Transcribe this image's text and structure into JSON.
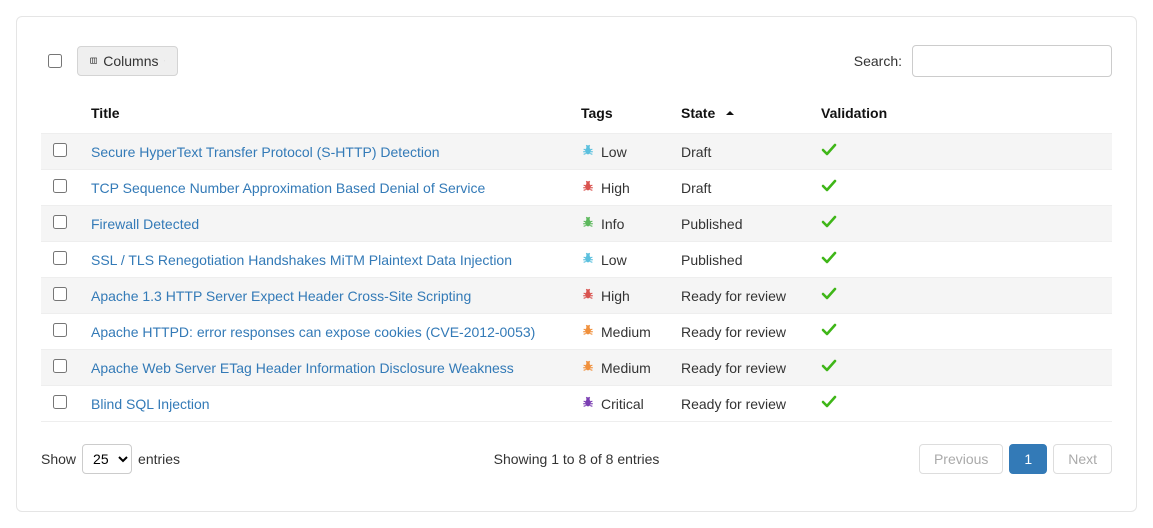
{
  "toolbar": {
    "columns_label": "Columns",
    "search_label": "Search:"
  },
  "columns": {
    "title": "Title",
    "tags": "Tags",
    "state": "State",
    "validation": "Validation"
  },
  "severity_colors": {
    "Critical": "#7b3fb3",
    "High": "#d9534f",
    "Medium": "#f0903c",
    "Low": "#5bc0de",
    "Info": "#5cb85c"
  },
  "rows": [
    {
      "title": "Secure HyperText Transfer Protocol (S-HTTP) Detection",
      "severity": "Low",
      "state": "Draft",
      "validated": true
    },
    {
      "title": "TCP Sequence Number Approximation Based Denial of Service",
      "severity": "High",
      "state": "Draft",
      "validated": true
    },
    {
      "title": "Firewall Detected",
      "severity": "Info",
      "state": "Published",
      "validated": true
    },
    {
      "title": "SSL / TLS Renegotiation Handshakes MiTM Plaintext Data Injection",
      "severity": "Low",
      "state": "Published",
      "validated": true
    },
    {
      "title": "Apache 1.3 HTTP Server Expect Header Cross-Site Scripting",
      "severity": "High",
      "state": "Ready for review",
      "validated": true
    },
    {
      "title": "Apache HTTPD: error responses can expose cookies (CVE-2012-0053)",
      "severity": "Medium",
      "state": "Ready for review",
      "validated": true
    },
    {
      "title": "Apache Web Server ETag Header Information Disclosure Weakness",
      "severity": "Medium",
      "state": "Ready for review",
      "validated": true
    },
    {
      "title": "Blind SQL Injection",
      "severity": "Critical",
      "state": "Ready for review",
      "validated": true
    }
  ],
  "footer": {
    "show_label_pre": "Show",
    "show_label_post": "entries",
    "page_size": "25",
    "info": "Showing 1 to 8 of 8 entries",
    "prev": "Previous",
    "next": "Next",
    "page": "1"
  }
}
